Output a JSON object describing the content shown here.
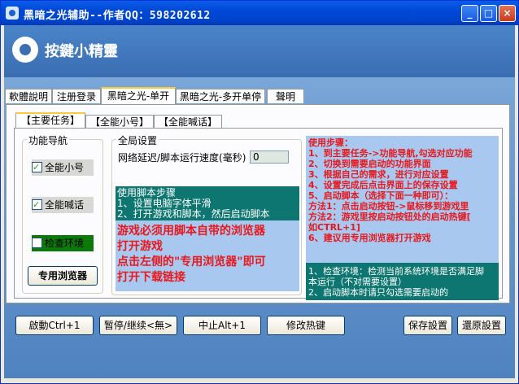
{
  "window": {
    "title": "黑暗之光辅助--作者QQ：598202612",
    "minimize": "_",
    "maximize": "□",
    "close": "×"
  },
  "banner": {
    "logo_text": "按鍵小精靈"
  },
  "top_tabs": [
    "軟體說明",
    "注册登录",
    "黑暗之光-单开",
    "黑暗之光-多开单停",
    "聲明"
  ],
  "inner_tabs": [
    "【主要任务】",
    "【全能小号】",
    "【全能喊话】"
  ],
  "nav": {
    "title": "功能导航",
    "items": [
      {
        "label": "全能小号",
        "checked": true
      },
      {
        "label": "全能喊话",
        "checked": true
      },
      {
        "label": "检查环境",
        "checked": false
      }
    ],
    "browser_button": "专用浏览器"
  },
  "global": {
    "title": "全局设置",
    "delay_label": "网络延迟/脚本运行速度(毫秒)",
    "delay_value": "0"
  },
  "script_steps": {
    "title": "使用脚本步骤",
    "lines": [
      "1、设置电脑字体平滑",
      "2、打开游戏和脚本，然后启动脚本"
    ]
  },
  "notice": {
    "lines": [
      "游戏必须用脚本自带的浏览器",
      "打开游戏",
      "点击左侧的\"专用浏览器\"即可",
      "打开下载链接"
    ]
  },
  "usage": {
    "lines": [
      "使用步骤：",
      "1、到主要任务->功能导航,勾选对应功能",
      "2、切换到需要启动的功能界面",
      "3、根据自己的需求，进行对应设置",
      "4、设置完成后点击界面上的保存设置",
      "5、启动脚本（选择下面一种即可）：",
      "方法1：点击启动按钮->鼠标移到游戏里",
      "方法2：游戏里按启动按钮处的启动热键[",
      "如CTRL+1]",
      "6、建议用专用浏览器打开游戏"
    ]
  },
  "hints": {
    "lines": [
      "1、检查环境：检测当前系统环境是否满足脚",
      "本运行（不对需要设置）",
      "2、启动脚本时请只勾选需要启动的"
    ]
  },
  "bottom_buttons": {
    "start": "啟動Ctrl+1",
    "pause": "暂停/继续<無>",
    "stop": "中止Alt+1",
    "hotkey": "修改热键",
    "save": "保存設置",
    "restore": "還原設置"
  }
}
